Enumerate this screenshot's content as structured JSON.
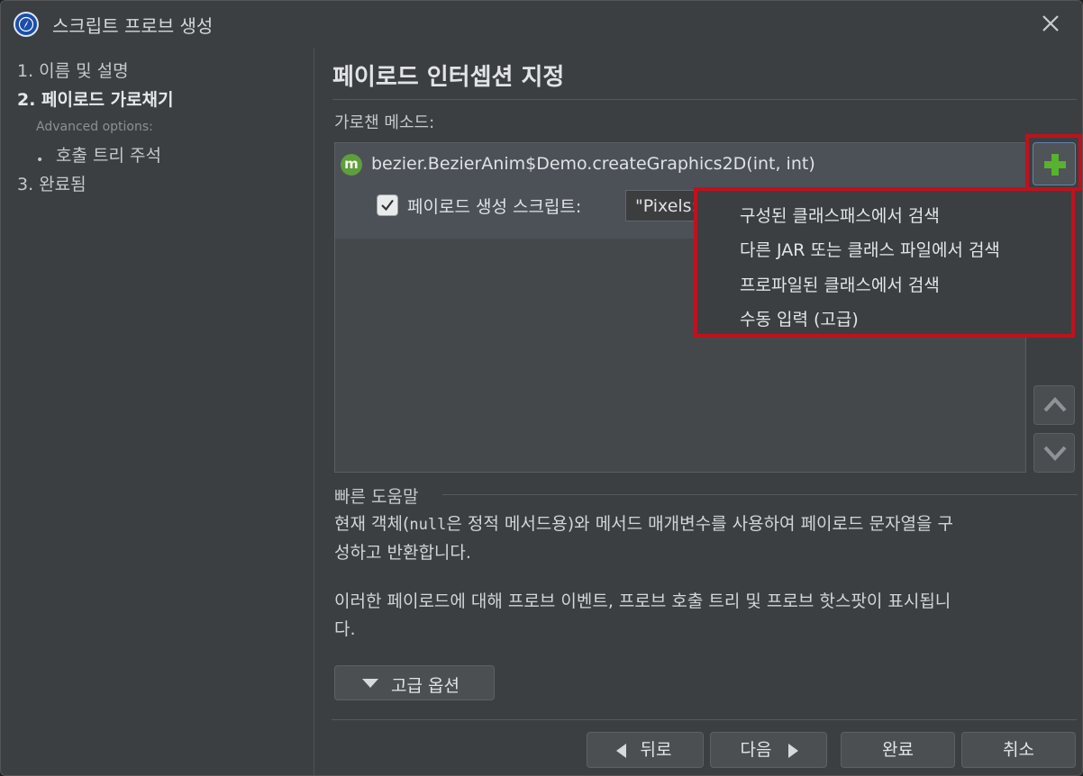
{
  "window": {
    "title": "스크립트 프로브 생성"
  },
  "sidebar": {
    "steps": [
      {
        "label": "1. 이름 및 설명"
      },
      {
        "label": "2. 페이로드 가로채기"
      },
      {
        "label": "3. 완료됨"
      }
    ],
    "advanced_label": "Advanced options:",
    "bullet_char": "•",
    "sub_item": "호출 트리 주석"
  },
  "main": {
    "title": "페이로드 인터셉션 지정",
    "methods_label": "가로챈 메소드:",
    "method": {
      "badge": "m",
      "name": "bezier.BezierAnim$Demo.createGraphics2D(int, int)",
      "checkbox_label": "페이로드 생성 스크립트:",
      "checked": true,
      "script_value": "\"Pixels:"
    }
  },
  "popup_menu": {
    "items": [
      "구성된 클래스패스에서 검색",
      "다른 JAR 또는 클래스 파일에서 검색",
      "프로파일된 클래스에서 검색",
      "수동 입력 (고급)"
    ]
  },
  "help": {
    "title": "빠른 도움말",
    "para1_a": "현재 객체(",
    "para1_code": "null",
    "para1_b": "은 정적 메서드용)와 메서드 매개변수를 사용하여 페이로드 문자열을 구",
    "para1_c": "성하고 반환합니다.",
    "para2_a": "이러한 페이로드에 대해 프로브 이벤트, 프로브 호출 트리 및 프로브 핫스팟이 표시됩니",
    "para2_b": "다."
  },
  "buttons": {
    "advanced": "고급 옵션",
    "back": "뒤로",
    "next": "다음",
    "finish": "완료",
    "cancel": "취소"
  },
  "colors": {
    "accent_outline": "#c0111d",
    "method_badge": "#5f9d3d",
    "add_plus": "#58b22e"
  }
}
